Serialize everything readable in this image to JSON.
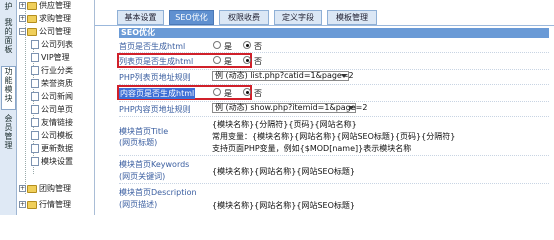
{
  "vertical_tabs": [
    {
      "label": "护",
      "active": false
    },
    {
      "label": "我的面板",
      "active": false
    },
    {
      "label": "功能模块",
      "active": true
    },
    {
      "label": "会员管理",
      "active": false
    }
  ],
  "tree": {
    "top_groups": [
      "供应管理",
      "求购管理",
      "公司管理"
    ],
    "company_items": [
      "公司列表",
      "VIP管理",
      "行业分类",
      "荣誉资质",
      "公司新闻",
      "公司单页",
      "友情链接",
      "公司模板",
      "更新数据",
      "模块设置"
    ],
    "bottom_groups": [
      "团购管理",
      "行情管理"
    ]
  },
  "tabs": [
    {
      "label": "基本设置",
      "active": false
    },
    {
      "label": "SEO优化",
      "active": true
    },
    {
      "label": "权限收费",
      "active": false
    },
    {
      "label": "定义字段",
      "active": false
    },
    {
      "label": "模板管理",
      "active": false
    }
  ],
  "section_title": "SEO优化",
  "options": {
    "yes": "是",
    "no": "否"
  },
  "rows": {
    "home_html": {
      "label": "首页是否生成html",
      "value": "否"
    },
    "list_html": {
      "label": "列表页是否生成html",
      "value": "否"
    },
    "list_url": {
      "label": "PHP列表页地址规则",
      "select": "例 (动态) list.php?catid=1&page=2"
    },
    "content_html": {
      "label": "内容页是否生成html",
      "value": "否"
    },
    "content_url": {
      "label": "PHP内容页地址规则",
      "select": "例 (动态) show.php?itemid=1&page=2"
    }
  },
  "title_block": {
    "label1": "模块首页Title",
    "label2": "(网页标题)",
    "line1": "{模块名称}{分隔符}{页码}{网站名称}",
    "line2": "常用变量：{模块名称}{网站名称}{网站SEO标题}{页码}{分隔符}",
    "line3": "支持页面PHP变量，例如{$MOD[name]}表示模块名称"
  },
  "keywords_block": {
    "label1": "模块首页Keywords",
    "label2": "(网页关键词)",
    "line1": "{模块名称}{网站名称}{网站SEO标题}"
  },
  "desc_block": {
    "label1": "模块首页Description",
    "label2": "(网页描述)",
    "line1": "{模块名称}{网站名称}{网站SEO标题}"
  },
  "colors": {
    "accent": "#5f90d0",
    "highlight": "#d0202a",
    "label": "#3a5ea0"
  }
}
